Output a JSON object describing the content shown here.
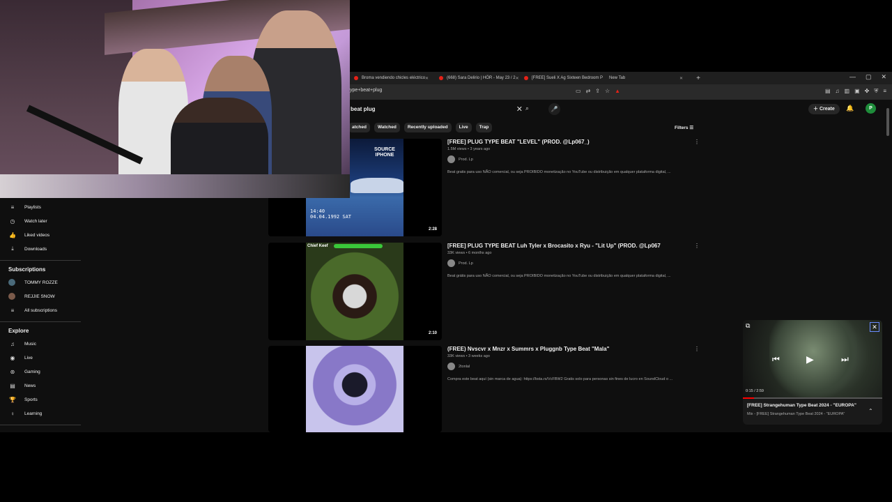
{
  "tabs": [
    {
      "label": "Broma vendiendo chicles eléctrico"
    },
    {
      "label": "(668) Sara Delirio | HÖR - May 23 / 2"
    },
    {
      "label": "[FREE] Sueli X Ag Sixteen Bedroom P"
    },
    {
      "label": "New Tab"
    }
  ],
  "address": {
    "url": "ype+beat+plug"
  },
  "search": {
    "value": "beat plug"
  },
  "header": {
    "create_label": "Create",
    "account_initial": "P"
  },
  "chips": [
    "atched",
    "Watched",
    "Recently uploaded",
    "Live",
    "Trap"
  ],
  "filters_label": "Filters",
  "sidebar": {
    "library": [
      {
        "label": "Playlists",
        "icon": "≡"
      },
      {
        "label": "Watch later",
        "icon": "◷"
      },
      {
        "label": "Liked videos",
        "icon": "👍"
      },
      {
        "label": "Downloads",
        "icon": "⤓"
      }
    ],
    "subscriptions_title": "Subscriptions",
    "subscriptions": [
      {
        "label": "TOMMY ROZZE",
        "color": "#4a6a7a"
      },
      {
        "label": "REJJIE SNOW",
        "color": "#7a5a4a"
      },
      {
        "label": "All subscriptions",
        "icon": "≡"
      }
    ],
    "explore_title": "Explore",
    "explore": [
      {
        "label": "Music",
        "icon": "♫"
      },
      {
        "label": "Live",
        "icon": "◉"
      },
      {
        "label": "Gaming",
        "icon": "⊛"
      },
      {
        "label": "News",
        "icon": "▤"
      },
      {
        "label": "Sports",
        "icon": "🏆"
      },
      {
        "label": "Learning",
        "icon": "♀"
      }
    ]
  },
  "results": [
    {
      "title": "[FREE] PLUG TYPE BEAT \"LEVEL\" (PROD. @Lp067_)",
      "meta": "1.5M views • 3 years ago",
      "channel": "Prod. Lp",
      "desc": "Beat gratis para uso NÃO comercial, ou seja PROIBIDO monetização no YouTube ou distribuição em qualquer plataforma digital, ...",
      "duration": "2:28",
      "thumb_text_1": "SOURCE",
      "thumb_text_2": "IPHONE",
      "thumb_text_3": "14:40",
      "thumb_text_4": "04.04.1992 SAT"
    },
    {
      "title": "[FREE] PLUG TYPE BEAT Luh Tyler x Brocasito x Ryu - \"Lit Up\" (PROD. @Lp067",
      "meta": "33K views • 6 months ago",
      "channel": "Prod. Lp",
      "desc": "Beat grátis para uso NÃO comercial, ou seja PROIBIDO monetização no YouTube ou distribuição em qualquer plataforma digital, ...",
      "duration": "2:10",
      "thumb_text_1": "Chief Keef"
    },
    {
      "title": "(FREE) Nvscvr x Mnzr x Summrs x Pluggnb Type Beat \"Mala\"",
      "meta": "33K views • 3 weeks ago",
      "channel": "2tonlal",
      "desc": "Compra este beat aquí (sin marca de agua): https://bsta.rs/VcFBW2 Gratis solo para personas sin fines de lucro en SoundCloud o ..."
    }
  ],
  "miniplayer": {
    "time": "0:15 / 2:59",
    "progress": 0.08,
    "title": "[FREE] Strangehuman Type Beat 2024 - \"EUROPA\"",
    "subtitle": "Mix - [FREE] Strangehuman Type Beat 2024 - \"EUROPA\""
  }
}
